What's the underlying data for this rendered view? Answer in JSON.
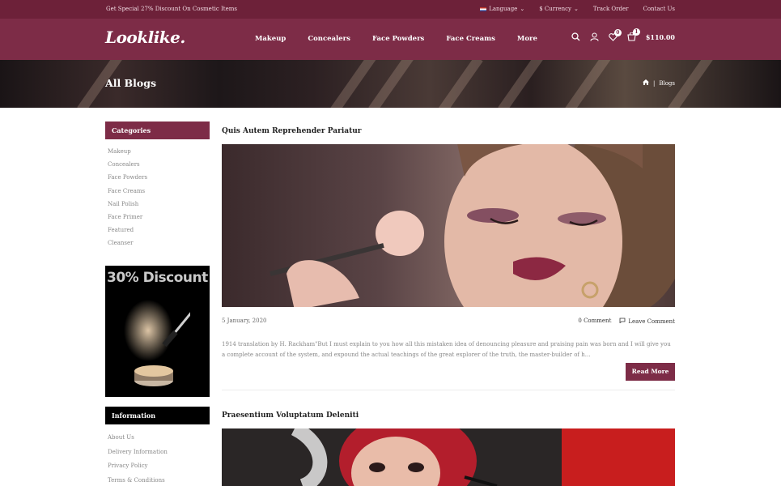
{
  "topbar": {
    "promo": "Get Special 27% Discount On Cosmetic Items",
    "language": "Language",
    "currency": "$ Currency",
    "track_order": "Track Order",
    "contact": "Contact Us"
  },
  "header": {
    "logo": "Looklike.",
    "nav": [
      "Makeup",
      "Concealers",
      "Face Powders",
      "Face Creams",
      "More"
    ],
    "wishlist_count": "0",
    "cart_count": "1",
    "cart_total": "$110.00"
  },
  "hero": {
    "title": "All Blogs",
    "breadcrumb_current": "Blogs"
  },
  "sidebar": {
    "categories_title": "Categories",
    "categories": [
      "Makeup",
      "Concealers",
      "Face Powders",
      "Face Creams",
      "Nail Polish",
      "Face Primer",
      "Featured",
      "Cleanser"
    ],
    "promo_text": "30% Discount",
    "information_title": "Information",
    "information": [
      "About Us",
      "Delivery Information",
      "Privacy Policy",
      "Terms & Conditions"
    ]
  },
  "posts": [
    {
      "title": "Quis Autem Reprehender Pariatur",
      "date": "5 January, 2020",
      "comments": "0 Comment",
      "leave_comment": "Leave Comment",
      "excerpt": "1914 translation by H. Rackham\"But I must explain to you how all this mistaken idea of denouncing pleasure and praising pain was born and I will give you a complete account of the system, and expound the actual teachings of the great explorer of the truth, the master-builder of h...",
      "read_more": "Read More"
    },
    {
      "title": "Praesentium Voluptatum Deleniti"
    }
  ],
  "colors": {
    "brand": "#7d2c47",
    "topbar": "#6d2139"
  }
}
